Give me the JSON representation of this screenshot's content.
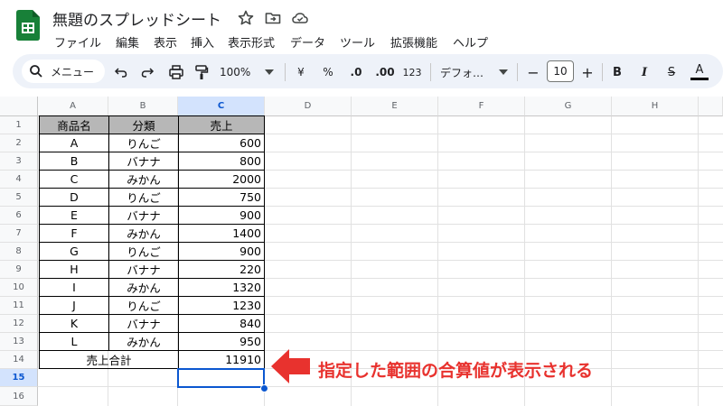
{
  "header": {
    "title": "無題のスプレッドシート",
    "icons": [
      "star-icon",
      "move-folder-icon",
      "cloud-saved-icon"
    ]
  },
  "menu": [
    "ファイル",
    "編集",
    "表示",
    "挿入",
    "表示形式",
    "データ",
    "ツール",
    "拡張機能",
    "ヘルプ"
  ],
  "toolbar": {
    "search_label": "メニュー",
    "zoom": "100%",
    "currency": "¥",
    "percent": "%",
    "decrease_decimal": ".0",
    "increase_decimal": ".00",
    "number_format": "123",
    "font": "デフォ…",
    "font_size": "10",
    "minus": "−",
    "plus": "+",
    "bold": "B",
    "italic": "I",
    "strike": "S",
    "text_color": "A"
  },
  "columns": [
    "A",
    "B",
    "C",
    "D",
    "E",
    "F",
    "G",
    "H"
  ],
  "rows": [
    "1",
    "2",
    "3",
    "4",
    "5",
    "6",
    "7",
    "8",
    "9",
    "10",
    "11",
    "12",
    "13",
    "14",
    "15",
    "16"
  ],
  "table": {
    "headers": [
      "商品名",
      "分類",
      "売上"
    ],
    "rows": [
      [
        "A",
        "りんご",
        "600"
      ],
      [
        "B",
        "バナナ",
        "800"
      ],
      [
        "C",
        "みかん",
        "2000"
      ],
      [
        "D",
        "りんご",
        "750"
      ],
      [
        "E",
        "バナナ",
        "900"
      ],
      [
        "F",
        "みかん",
        "1400"
      ],
      [
        "G",
        "りんご",
        "900"
      ],
      [
        "H",
        "バナナ",
        "220"
      ],
      [
        "I",
        "みかん",
        "1320"
      ],
      [
        "J",
        "りんご",
        "1230"
      ],
      [
        "K",
        "バナナ",
        "840"
      ],
      [
        "L",
        "みかん",
        "950"
      ]
    ],
    "total_label": "売上合計",
    "total_value": "11910"
  },
  "selected": {
    "column": "C",
    "row": "15"
  },
  "callout": "指定した範囲の合算値が表示される",
  "colors": {
    "accent": "#0b57d0",
    "callout": "#e8322e",
    "sheets_green": "#188038",
    "header_fill": "#b7b7b7"
  }
}
